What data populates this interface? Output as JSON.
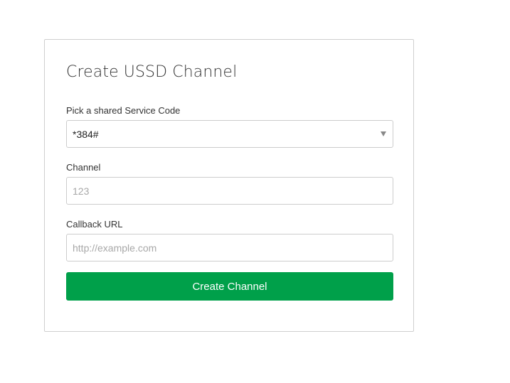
{
  "form": {
    "title": "Create USSD Channel",
    "service_code": {
      "label": "Pick a shared Service Code",
      "selected": "*384#"
    },
    "channel": {
      "label": "Channel",
      "value": "",
      "placeholder": "123"
    },
    "callback_url": {
      "label": "Callback URL",
      "value": "",
      "placeholder": "http://example.com"
    },
    "submit_label": "Create Channel"
  },
  "colors": {
    "primary_button": "#00a04a",
    "card_border": "#cfcfcf",
    "input_border": "#cccccc",
    "placeholder": "#a8a8a8"
  },
  "icons": {
    "select_caret": "chevron-down-icon"
  }
}
